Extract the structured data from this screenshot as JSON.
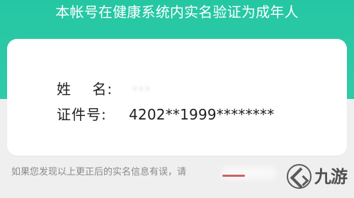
{
  "banner": {
    "title": "本帐号在健康系统内实名验证为成年人"
  },
  "identity": {
    "name_label": "姓    名:",
    "name_value": "•••",
    "id_label": "证件号:",
    "id_value": "4202**1999********"
  },
  "footer": {
    "hint": "如果您发现以上更正后的实名信息有误，请",
    "logo_text": "九游"
  },
  "colors": {
    "accent": "#2cc7a6",
    "text_primary": "#202020",
    "text_secondary": "#8a8a8a",
    "card_background": "#ffffff",
    "page_background": "#efefef"
  }
}
